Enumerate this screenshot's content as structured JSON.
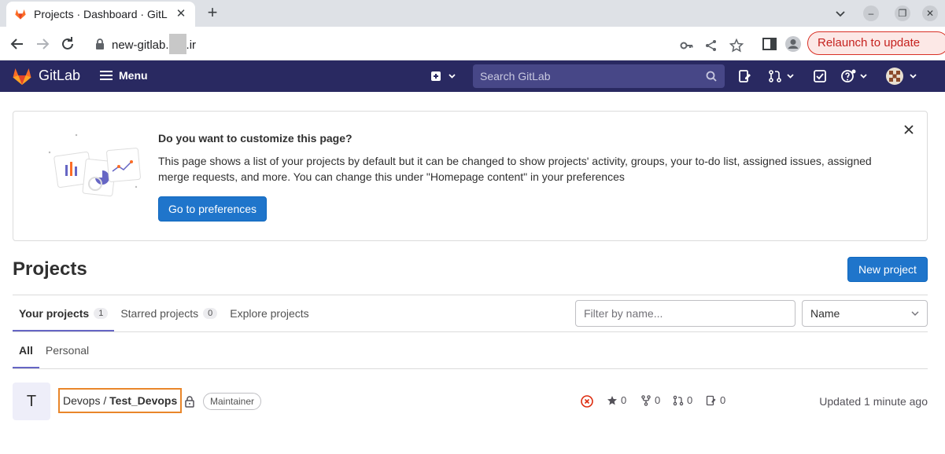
{
  "browser": {
    "tab_title": "Projects · Dashboard · GitL",
    "url_prefix": "new-gitlab.",
    "url_suffix": ".ir",
    "relaunch_label": "Relaunch to update"
  },
  "gitlab_nav": {
    "brand": "GitLab",
    "menu_label": "Menu",
    "search_placeholder": "Search GitLab"
  },
  "banner": {
    "title": "Do you want to customize this page?",
    "text": "This page shows a list of your projects by default but it can be changed to show projects' activity, groups, your to-do list, assigned issues, assigned merge requests, and more. You can change this under \"Homepage content\" in your preferences",
    "button_label": "Go to preferences"
  },
  "page": {
    "title": "Projects",
    "new_project_label": "New project"
  },
  "tabs": [
    {
      "label": "Your projects",
      "count": "1"
    },
    {
      "label": "Starred projects",
      "count": "0"
    },
    {
      "label": "Explore projects"
    }
  ],
  "filter": {
    "placeholder": "Filter by name...",
    "sort_value": "Name"
  },
  "subtabs": [
    {
      "label": "All"
    },
    {
      "label": "Personal"
    }
  ],
  "project": {
    "avatar_letter": "T",
    "namespace": "Devops / ",
    "name": "Test_Devops",
    "role": "Maintainer",
    "stars": "0",
    "forks": "0",
    "merge_requests": "0",
    "issues": "0",
    "updated": "Updated 1 minute ago"
  },
  "colors": {
    "nav_bg": "#292961",
    "primary": "#1f75cb",
    "highlight_border": "#e9862a",
    "pipeline_failed": "#dd2b0e"
  }
}
